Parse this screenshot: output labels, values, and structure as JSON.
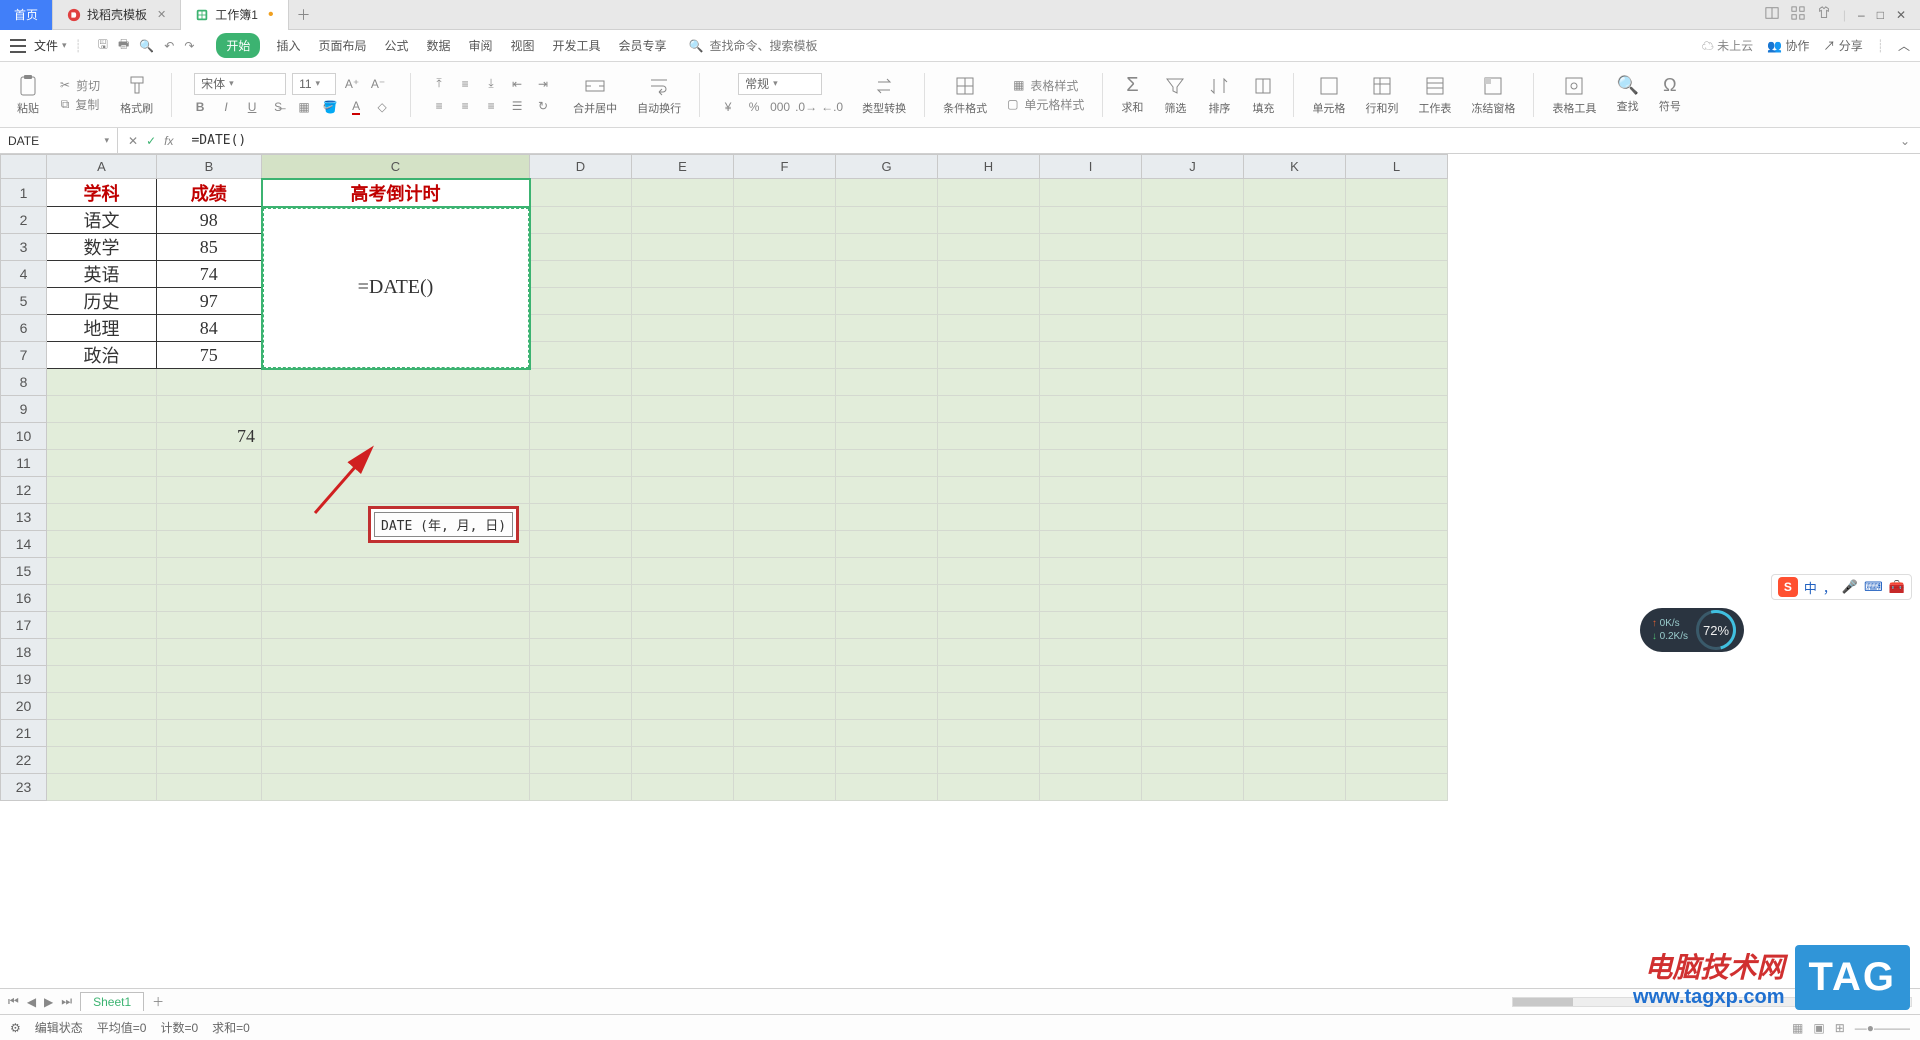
{
  "titlebar": {
    "tabs": [
      {
        "label": "首页"
      },
      {
        "label": "找稻壳模板"
      },
      {
        "label": "工作簿1"
      }
    ]
  },
  "win": {
    "close": "✕",
    "min": "–",
    "max": "□"
  },
  "menu": {
    "file": "文件",
    "tabs": [
      "开始",
      "插入",
      "页面布局",
      "公式",
      "数据",
      "审阅",
      "视图",
      "开发工具",
      "会员专享"
    ],
    "searchPlaceholder": "查找命令、搜索模板",
    "cloud": "未上云",
    "coop": "协作",
    "share": "分享"
  },
  "ribbon": {
    "paste": "粘贴",
    "cut": "剪切",
    "copy": "复制",
    "formatPainter": "格式刷",
    "font": "宋体",
    "fontSize": "11",
    "mergeCenter": "合并居中",
    "wrap": "自动换行",
    "numFmt": "常规",
    "typeConvert": "类型转换",
    "cond": "条件格式",
    "tableStyle": "表格样式",
    "cellStyle": "单元格样式",
    "sum": "求和",
    "filter": "筛选",
    "sort": "排序",
    "fill": "填充",
    "cell": "单元格",
    "rowcol": "行和列",
    "worksheet": "工作表",
    "freeze": "冻结窗格",
    "tableTool": "表格工具",
    "find": "查找",
    "symbol": "符号"
  },
  "formulabar": {
    "name": "DATE",
    "formula": "=DATE()"
  },
  "columns": [
    "A",
    "B",
    "C",
    "D",
    "E",
    "F",
    "G",
    "H",
    "I",
    "J",
    "K",
    "L"
  ],
  "rowCount": 23,
  "cells": {
    "a1": "学科",
    "b1": "成绩",
    "c1": "高考倒计时",
    "a2": "语文",
    "b2": "98",
    "a3": "数学",
    "b3": "85",
    "a4": "英语",
    "b4": "74",
    "a5": "历史",
    "b5": "97",
    "a6": "地理",
    "b6": "84",
    "a7": "政治",
    "b7": "75",
    "b10": "74",
    "c_editing": "=DATE()"
  },
  "tooltip": "DATE (年, 月, 日)",
  "sheettab": "Sheet1",
  "status": {
    "mode": "编辑状态",
    "avg": "平均值=0",
    "count": "计数=0",
    "sum": "求和=0"
  },
  "watermark": {
    "t1": "电脑技术网",
    "t2": "www.tagxp.com",
    "tag": "TAG"
  },
  "ime": {
    "lang": "中",
    "punct": "，",
    "full": "●"
  },
  "perf": {
    "up": "0K/s",
    "dn": "0.2K/s",
    "pct": "72%"
  },
  "chart_data": {
    "type": "table",
    "title": "高考倒计时",
    "columns": [
      "学科",
      "成绩"
    ],
    "rows": [
      [
        "语文",
        98
      ],
      [
        "数学",
        85
      ],
      [
        "英语",
        74
      ],
      [
        "历史",
        97
      ],
      [
        "地理",
        84
      ],
      [
        "政治",
        75
      ]
    ],
    "extra": {
      "B10": 74
    },
    "editing_cell": {
      "ref": "C2:C7",
      "formula": "=DATE()"
    }
  }
}
